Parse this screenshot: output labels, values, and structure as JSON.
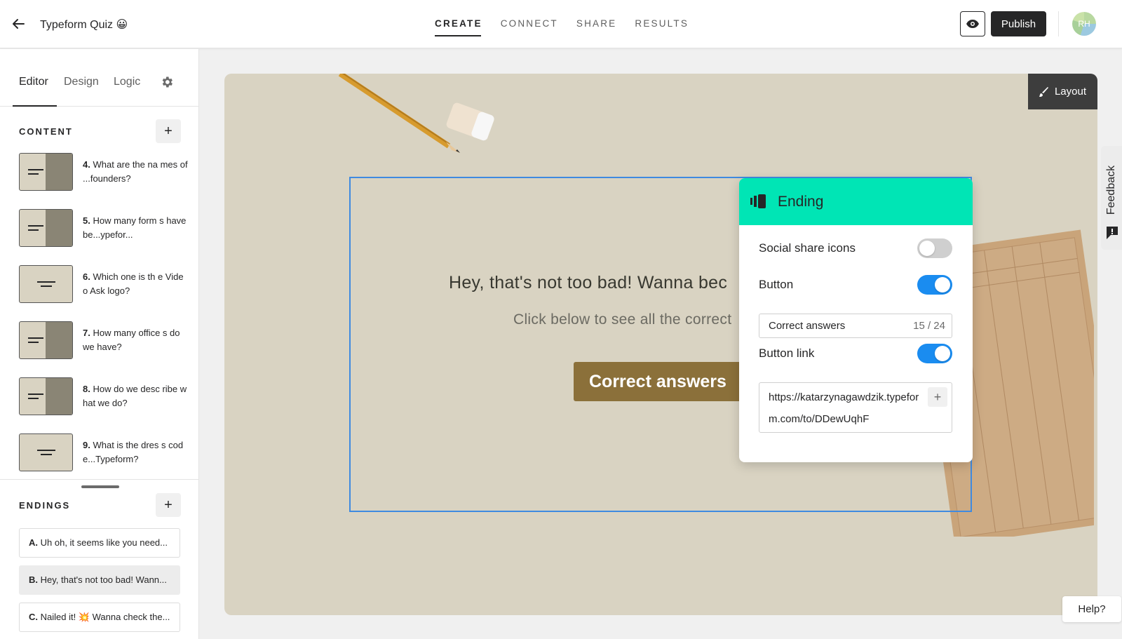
{
  "header": {
    "form_title": "Typeform Quiz 😀",
    "nav": [
      "CREATE",
      "CONNECT",
      "SHARE",
      "RESULTS"
    ],
    "active_nav": "CREATE",
    "publish_label": "Publish",
    "avatar_initials": "RH"
  },
  "sidebar": {
    "tabs": [
      "Editor",
      "Design",
      "Logic"
    ],
    "active_tab": "Editor",
    "content_label": "CONTENT",
    "questions": [
      {
        "num": "4.",
        "text": "What are the na mes of ...founders?",
        "thumb": "split"
      },
      {
        "num": "5.",
        "text": "How many form s have be...ypefor...",
        "thumb": "split"
      },
      {
        "num": "6.",
        "text": "Which one is th e Video Ask logo?",
        "thumb": "center"
      },
      {
        "num": "7.",
        "text": "How many office s do we have?",
        "thumb": "split"
      },
      {
        "num": "8.",
        "text": "How do we desc ribe what we do?",
        "thumb": "split"
      },
      {
        "num": "9.",
        "text": "What is the dres s code...Typeform?",
        "thumb": "center"
      }
    ],
    "endings_label": "ENDINGS",
    "endings": [
      {
        "letter": "A.",
        "text": "Uh oh, it seems like you need..."
      },
      {
        "letter": "B.",
        "text": "Hey, that's not too bad! Wann..."
      },
      {
        "letter": "C.",
        "text": "Nailed it! 💥 Wanna check the..."
      }
    ],
    "selected_ending": "B."
  },
  "canvas": {
    "layout_label": "Layout",
    "headline": "Hey, that's not too bad! Wanna bec",
    "subline": "Click below to see all the correct",
    "button_label": "Correct answers",
    "background_color": "#d9d3c2",
    "button_color": "#8b703a"
  },
  "popover": {
    "title": "Ending",
    "header_color": "#00e5b5",
    "social_share_label": "Social share icons",
    "social_share_on": false,
    "button_label": "Button",
    "button_on": true,
    "button_text_value": "Correct answers",
    "button_text_count": "15 / 24",
    "button_link_label": "Button link",
    "button_link_on": true,
    "button_link_value": "https://katarzynagawdzik.typeform.com/to/DDewUqhF"
  },
  "feedback_label": "Feedback",
  "help_label": "Help?"
}
